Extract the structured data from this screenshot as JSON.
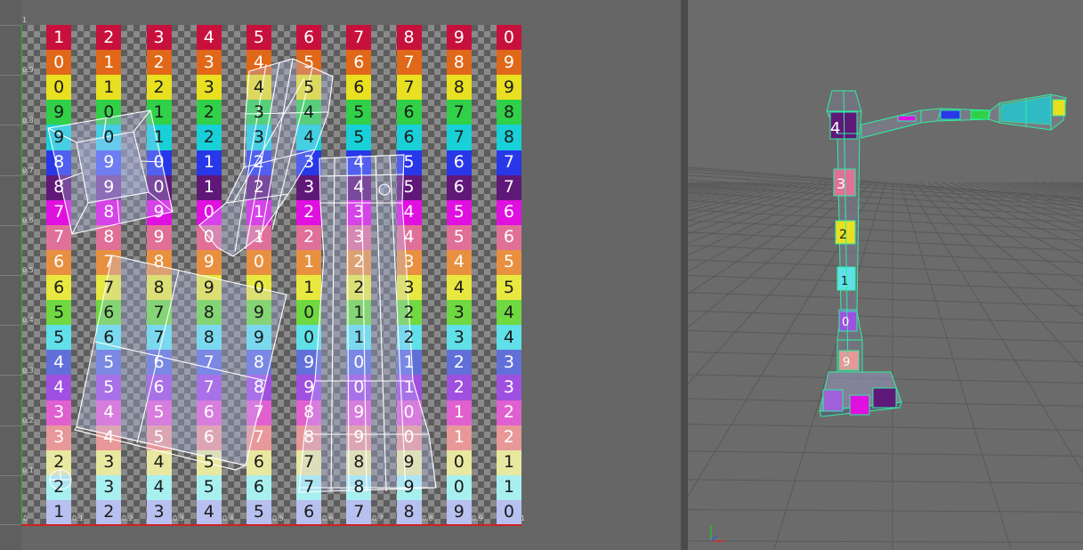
{
  "uv_editor": {
    "grid_rows": [
      [
        "1",
        "2",
        "3",
        "4",
        "5",
        "6",
        "7",
        "8",
        "9",
        "0"
      ],
      [
        "0",
        "1",
        "2",
        "3",
        "4",
        "5",
        "6",
        "7",
        "8",
        "9"
      ],
      [
        "0",
        "1",
        "2",
        "3",
        "4",
        "5",
        "6",
        "7",
        "8",
        "9"
      ],
      [
        "9",
        "0",
        "1",
        "2",
        "3",
        "4",
        "5",
        "6",
        "7",
        "8"
      ],
      [
        "9",
        "0",
        "1",
        "2",
        "3",
        "4",
        "5",
        "6",
        "7",
        "8"
      ],
      [
        "8",
        "9",
        "0",
        "1",
        "2",
        "3",
        "4",
        "5",
        "6",
        "7"
      ],
      [
        "8",
        "9",
        "0",
        "1",
        "2",
        "3",
        "4",
        "5",
        "6",
        "7"
      ],
      [
        "7",
        "8",
        "9",
        "0",
        "1",
        "2",
        "3",
        "4",
        "5",
        "6"
      ],
      [
        "7",
        "8",
        "9",
        "0",
        "1",
        "2",
        "3",
        "4",
        "5",
        "6"
      ],
      [
        "6",
        "7",
        "8",
        "9",
        "0",
        "1",
        "2",
        "3",
        "4",
        "5"
      ],
      [
        "6",
        "7",
        "8",
        "9",
        "0",
        "1",
        "2",
        "3",
        "4",
        "5"
      ],
      [
        "5",
        "6",
        "7",
        "8",
        "9",
        "0",
        "1",
        "2",
        "3",
        "4"
      ],
      [
        "5",
        "6",
        "7",
        "8",
        "9",
        "0",
        "1",
        "2",
        "3",
        "4"
      ],
      [
        "4",
        "5",
        "6",
        "7",
        "8",
        "9",
        "0",
        "1",
        "2",
        "3"
      ],
      [
        "4",
        "5",
        "6",
        "7",
        "8",
        "9",
        "0",
        "1",
        "2",
        "3"
      ],
      [
        "3",
        "4",
        "5",
        "6",
        "7",
        "8",
        "9",
        "0",
        "1",
        "2"
      ],
      [
        "3",
        "4",
        "5",
        "6",
        "7",
        "8",
        "9",
        "0",
        "1",
        "2"
      ],
      [
        "2",
        "3",
        "4",
        "5",
        "6",
        "7",
        "8",
        "9",
        "0",
        "1"
      ],
      [
        "2",
        "3",
        "4",
        "5",
        "6",
        "7",
        "8",
        "9",
        "0",
        "1"
      ],
      [
        "1",
        "2",
        "3",
        "4",
        "5",
        "6",
        "7",
        "8",
        "9",
        "0"
      ]
    ],
    "row_colors": [
      "#c8103c",
      "#e06818",
      "#e8e020",
      "#30d048",
      "#18d0d8",
      "#2838e8",
      "#601878",
      "#e010e0",
      "#e07098",
      "#e89040",
      "#e8e840",
      "#70d840",
      "#60e0e8",
      "#6070d8",
      "#a050e0",
      "#e060d0",
      "#e89898",
      "#e8e8a0",
      "#a8f0f0",
      "#b8c0f0"
    ],
    "dark_text_rows": [
      2,
      3,
      4,
      10,
      11,
      12,
      17,
      18,
      19
    ],
    "u_ticks": [
      "0",
      "0.1",
      "0.2",
      "0.3",
      "0.4",
      "0.5",
      "0.6",
      "0.7",
      "0.8",
      "0.9",
      "1"
    ],
    "v_ticks": [
      "1",
      "0.9",
      "0.8",
      "0.7",
      "0.6",
      "0.5",
      "0.4",
      "0.3",
      "0.2",
      "0.1",
      "0"
    ],
    "wireframe_color": "#ffffff"
  },
  "viewport": {
    "background_color": "#6b6b6b",
    "grid_color": "#595959",
    "wire_color": "#2df0a0",
    "model_labels": [
      "4",
      "3",
      "2",
      "1",
      "0",
      "9"
    ]
  }
}
